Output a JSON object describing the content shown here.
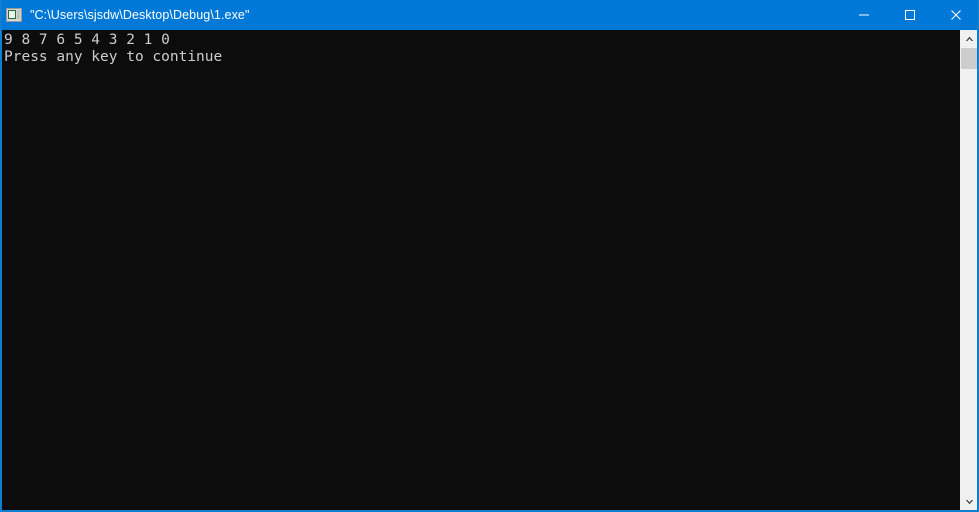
{
  "window": {
    "title": "\"C:\\Users\\sjsdw\\Desktop\\Debug\\1.exe\"",
    "icon_name": "console-app-icon",
    "titlebar_color": "#0078d7",
    "border_color": "#0f7fd4"
  },
  "window_controls": {
    "minimize_label": "Minimize",
    "maximize_label": "Maximize",
    "close_label": "Close"
  },
  "console": {
    "background": "#0c0c0c",
    "foreground": "#cccccc",
    "lines": [
      "9 8 7 6 5 4 3 2 1 0",
      "Press any key to continue"
    ]
  },
  "scrollbar": {
    "up_arrow_label": "Scroll up",
    "down_arrow_label": "Scroll down",
    "track_color": "#f0f0f0",
    "thumb_color": "#cdcdcd"
  }
}
